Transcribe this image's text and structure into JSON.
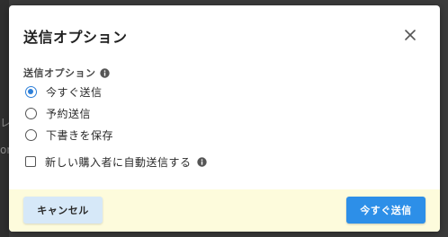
{
  "dialog": {
    "title": "送信オプション",
    "section_label": "送信オプション",
    "options": [
      {
        "label": "今すぐ送信",
        "selected": true
      },
      {
        "label": "予約送信",
        "selected": false
      },
      {
        "label": "下書きを保存",
        "selected": false
      }
    ],
    "checkbox": {
      "label": "新しい購入者に自動送信する",
      "checked": false
    },
    "cancel_label": "キャンセル",
    "primary_label": "今すぐ送信"
  },
  "backdrop": {
    "fragments": [
      "レ",
      "on"
    ]
  },
  "colors": {
    "accent": "#2d8fe8",
    "radio_selected": "#2d7fd8",
    "footer_bg": "#fdfbdc",
    "cancel_bg": "#d6e8f8"
  },
  "icons": {
    "close": "close-icon",
    "info": "info-icon"
  }
}
